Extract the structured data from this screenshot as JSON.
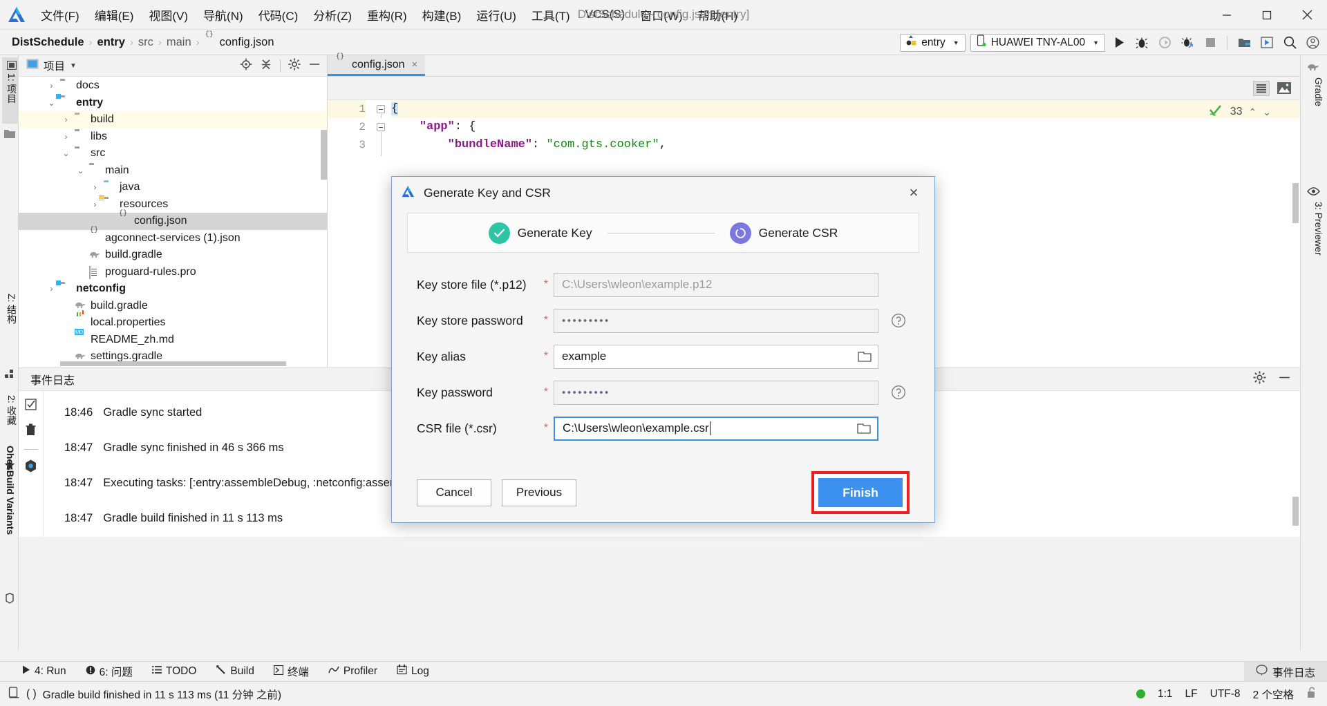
{
  "window": {
    "title": "DistSchedule - config.json [entry]",
    "logo": "devicco-logo-icon",
    "minimize": "minimize-icon",
    "maximize": "maximize-icon",
    "close": "close-icon"
  },
  "menubar": {
    "items": [
      {
        "label": "文件(F)"
      },
      {
        "label": "编辑(E)"
      },
      {
        "label": "视图(V)"
      },
      {
        "label": "导航(N)"
      },
      {
        "label": "代码(C)"
      },
      {
        "label": "分析(Z)"
      },
      {
        "label": "重构(R)"
      },
      {
        "label": "构建(B)"
      },
      {
        "label": "运行(U)"
      },
      {
        "label": "工具(T)"
      },
      {
        "label": "VCS(S)"
      },
      {
        "label": "窗口(W)"
      },
      {
        "label": "帮助(H)"
      }
    ]
  },
  "breadcrumb": {
    "items": [
      "DistSchedule",
      "entry",
      "src",
      "main",
      "config.json"
    ],
    "separator": "›"
  },
  "toolbar": {
    "run_config": "entry",
    "device": "HUAWEI TNY-AL00",
    "icons": [
      "run-icon",
      "debug-icon",
      "run-coverage-icon",
      "attach-debugger-icon",
      "stop-icon",
      "project-structure-icon",
      "device-manager-icon",
      "search-everywhere-icon",
      "account-icon"
    ]
  },
  "left_strip": {
    "tabs": [
      {
        "label": "1: 项目",
        "icon": "project-tab-icon",
        "selected": true
      },
      {
        "label": "2: 收藏",
        "icon": "favorites-tab-icon",
        "selected": false
      },
      {
        "label": "OhosBuild Variants",
        "icon": "build-variants-icon",
        "selected": false
      },
      {
        "label": "Z: 结构",
        "icon": "structure-tab-icon",
        "selected": false
      }
    ]
  },
  "right_strip": {
    "tabs": [
      {
        "label": "Gradle",
        "icon": "gradle-elephant-icon"
      },
      {
        "label": "3: Previewer",
        "icon": "eye-icon"
      }
    ]
  },
  "project_panel": {
    "title": "项目",
    "dropdown_caret": "▼",
    "icons": [
      "locate-icon",
      "collapse-all-icon",
      "settings-gear-icon",
      "hide-icon"
    ],
    "tree": [
      {
        "label": "docs",
        "indent": 1,
        "arrow": "›",
        "icon": "folder-gray",
        "style": "normal",
        "row": "normal"
      },
      {
        "label": "entry",
        "indent": 1,
        "arrow": "⌄",
        "icon": "folder-module",
        "style": "bold",
        "row": "normal"
      },
      {
        "label": "build",
        "indent": 2,
        "arrow": "›",
        "icon": "folder-orange",
        "style": "normal",
        "row": "yellow"
      },
      {
        "label": "libs",
        "indent": 2,
        "arrow": "›",
        "icon": "folder-gray",
        "style": "normal",
        "row": "normal"
      },
      {
        "label": "src",
        "indent": 2,
        "arrow": "⌄",
        "icon": "folder-gray",
        "style": "normal",
        "row": "normal"
      },
      {
        "label": "main",
        "indent": 3,
        "arrow": "⌄",
        "icon": "folder-gray",
        "style": "normal",
        "row": "normal"
      },
      {
        "label": "java",
        "indent": 4,
        "arrow": "›",
        "icon": "folder-blue",
        "style": "normal",
        "row": "normal"
      },
      {
        "label": "resources",
        "indent": 4,
        "arrow": "›",
        "icon": "folder-res",
        "style": "normal",
        "row": "normal"
      },
      {
        "label": "config.json",
        "indent": 5,
        "arrow": "",
        "icon": "file-json",
        "style": "normal",
        "row": "selected"
      },
      {
        "label": "agconnect-services (1).json",
        "indent": 3,
        "arrow": "",
        "icon": "file-json",
        "style": "normal",
        "row": "normal"
      },
      {
        "label": "build.gradle",
        "indent": 3,
        "arrow": "",
        "icon": "file-gradle",
        "style": "normal",
        "row": "normal"
      },
      {
        "label": "proguard-rules.pro",
        "indent": 3,
        "arrow": "",
        "icon": "file-pro",
        "style": "normal",
        "row": "normal"
      },
      {
        "label": "netconfig",
        "indent": 1,
        "arrow": "›",
        "icon": "folder-module",
        "style": "bold",
        "row": "normal"
      },
      {
        "label": "build.gradle",
        "indent": 2,
        "arrow": "",
        "icon": "file-gradle",
        "style": "normal",
        "row": "normal"
      },
      {
        "label": "local.properties",
        "indent": 2,
        "arrow": "",
        "icon": "file-props",
        "style": "normal",
        "row": "normal"
      },
      {
        "label": "README_zh.md",
        "indent": 2,
        "arrow": "",
        "icon": "file-md",
        "style": "normal",
        "row": "normal"
      },
      {
        "label": "settings.gradle",
        "indent": 2,
        "arrow": "",
        "icon": "file-gradle",
        "style": "normal",
        "row": "normal"
      }
    ]
  },
  "editor": {
    "tab": {
      "label": "config.json",
      "icon": "json-file-icon",
      "close": "×"
    },
    "subbar_icons": [
      "text-view-icon",
      "preview-image-icon"
    ],
    "inspection": {
      "status_icon": "inspections-ok-icon",
      "count": "33",
      "prev": "⌃",
      "next": "⌄"
    },
    "lines": [
      {
        "num": "1",
        "parts": [
          {
            "t": "{",
            "c": "k-brace"
          }
        ],
        "indent": 0,
        "highlight": true,
        "fold": true
      },
      {
        "num": "2",
        "parts": [
          {
            "t": "\"app\"",
            "c": "k-key"
          },
          {
            "t": ": {",
            "c": "k-punc"
          }
        ],
        "indent": 1,
        "highlight": false,
        "fold": true
      },
      {
        "num": "3",
        "parts": [
          {
            "t": "\"bundleName\"",
            "c": "k-key"
          },
          {
            "t": ": ",
            "c": "k-punc"
          },
          {
            "t": "\"com.gts.cooker\"",
            "c": "k-str"
          },
          {
            "t": ",",
            "c": "k-punc"
          }
        ],
        "indent": 2,
        "highlight": false,
        "fold": false
      }
    ]
  },
  "event_log": {
    "title": "事件日志",
    "head_icons": [
      "settings-gear-icon",
      "hide-panel-icon"
    ],
    "tool_icons": [
      "mark-read-icon",
      "delete-icon",
      "separator",
      "settings-icon"
    ],
    "entries": [
      {
        "time": "18:46",
        "message": "Gradle sync started"
      },
      {
        "time": "18:47",
        "message": "Gradle sync finished in 46 s 366 ms"
      },
      {
        "time": "18:47",
        "message": "Executing tasks: [:entry:assembleDebug, :netconfig:assembleDebug] in project C:\\Mydemo\\knowledge_demo_smart_home-master\\FA\\DistSchedule"
      },
      {
        "time": "18:47",
        "message": "Gradle build finished in 11 s 113 ms"
      }
    ]
  },
  "bottom_tabs": {
    "items": [
      {
        "label": "4: Run",
        "icon": "run-small-icon",
        "mnemonic": "4"
      },
      {
        "label": "6: 问题",
        "icon": "problems-icon",
        "mnemonic": "6"
      },
      {
        "label": "TODO",
        "icon": "todo-icon",
        "mnemonic": ""
      },
      {
        "label": "Build",
        "icon": "build-hammer-icon",
        "mnemonic": ""
      },
      {
        "label": "终端",
        "icon": "terminal-icon",
        "mnemonic": ""
      },
      {
        "label": "Profiler",
        "icon": "profiler-icon",
        "mnemonic": ""
      },
      {
        "label": "Log",
        "icon": "log-icon",
        "mnemonic": ""
      }
    ],
    "right_tab": {
      "label": "事件日志",
      "icon": "event-log-balloon-icon"
    }
  },
  "statusbar": {
    "icon": "ide-status-icon",
    "parens": "( )",
    "message": "Gradle build finished in 11 s 113 ms (11 分钟 之前)",
    "caret_position": "1:1",
    "line_separator": "LF",
    "encoding": "UTF-8",
    "indent": "2 个空格",
    "lock_icon": "unlocked-icon",
    "indicator_color": "#2eaf2e"
  },
  "dialog": {
    "title": "Generate Key and CSR",
    "icon": "devicco-logo-icon",
    "close": "×",
    "steps": [
      {
        "label": "Generate Key",
        "state": "done",
        "icon": "check-icon",
        "color": "#2ec4a6"
      },
      {
        "label": "Generate CSR",
        "state": "current",
        "icon": "spinner-icon",
        "color": "#7b79e0"
      }
    ],
    "fields": [
      {
        "label": "Key store file (*.p12)",
        "required": "*",
        "value": "",
        "placeholder": "C:\\Users\\wleon\\example.p12",
        "type": "text",
        "state": "readonly",
        "browse": false,
        "help": false
      },
      {
        "label": "Key store password",
        "required": "*",
        "value": "•••••••••",
        "placeholder": "",
        "type": "password",
        "state": "readonly",
        "browse": false,
        "help": true
      },
      {
        "label": "Key alias",
        "required": "*",
        "value": "example",
        "placeholder": "",
        "type": "text",
        "state": "editable",
        "browse": true,
        "help": false
      },
      {
        "label": "Key password",
        "required": "*",
        "value": "•••••••••",
        "placeholder": "",
        "type": "password",
        "state": "readonly",
        "browse": false,
        "help": true
      },
      {
        "label": "CSR file (*.csr)",
        "required": "*",
        "value": "C:\\Users\\wleon\\example.csr",
        "placeholder": "",
        "type": "text",
        "state": "focused",
        "browse": true,
        "help": false
      }
    ],
    "buttons": {
      "cancel": "Cancel",
      "previous": "Previous",
      "finish": "Finish",
      "finish_highlight_color": "#f01e1e",
      "finish_bg": "#3d91ee"
    }
  }
}
